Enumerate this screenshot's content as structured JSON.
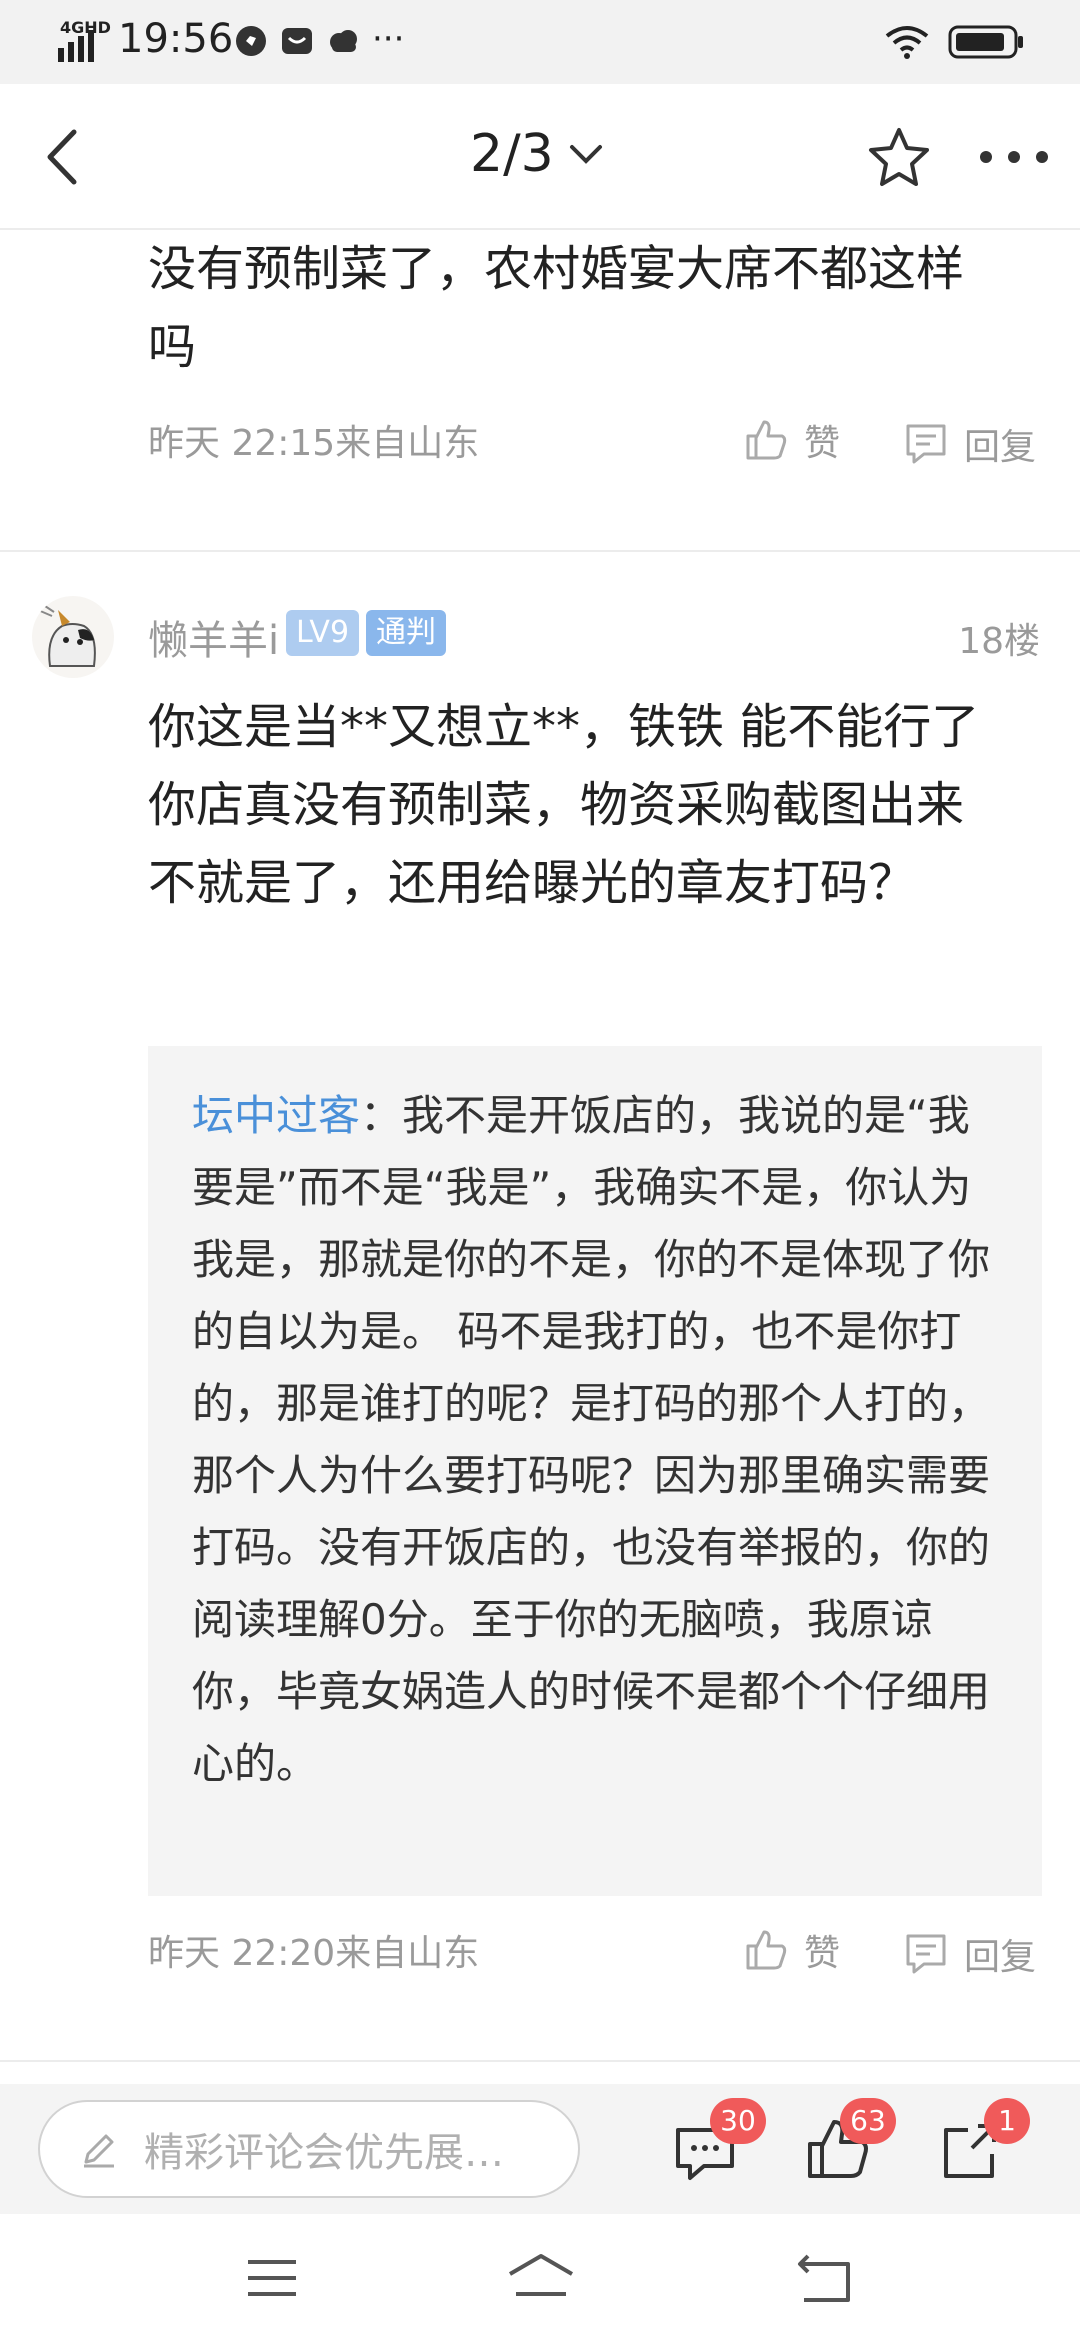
{
  "status_bar": {
    "network": "4GHD",
    "time": "19:56",
    "more": "···"
  },
  "nav": {
    "title": "2/3"
  },
  "comment_prev": {
    "text": "没有预制菜了，农村婚宴大席不都这样吗",
    "meta": "昨天 22:15来自山东",
    "like_label": "赞",
    "reply_label": "回复"
  },
  "comment": {
    "username": "懒羊羊i",
    "level": "LV9",
    "role": "通判",
    "floor": "18楼",
    "text": "你这是当**又想立**，铁铁 能不能行了 你店真没有预制菜，物资采购截图出来不就是了，还用给曝光的章友打码？",
    "quote_author": "坛中过客",
    "quote_sep": "：",
    "quote_text": "我不是开饭店的，我说的是“我要是”而不是“我是”，我确实不是，你认为我是，那就是你的不是，你的不是体现了你的自以为是。 码不是我打的，也不是你打的，那是谁打的呢？是打码的那个人打的，那个人为什么要打码呢？因为那里确实需要打码。没有开饭店的，也没有举报的，你的阅读理解0分。至于你的无脑喷，我原谅你，毕竟女娲造人的时候不是都个个仔细用心的。",
    "meta": "昨天 22:20来自山东",
    "like_label": "赞",
    "reply_label": "回复"
  },
  "bottom_bar": {
    "placeholder": "精彩评论会优先展…",
    "comments_count": "30",
    "likes_count": "63",
    "shares_count": "1"
  }
}
